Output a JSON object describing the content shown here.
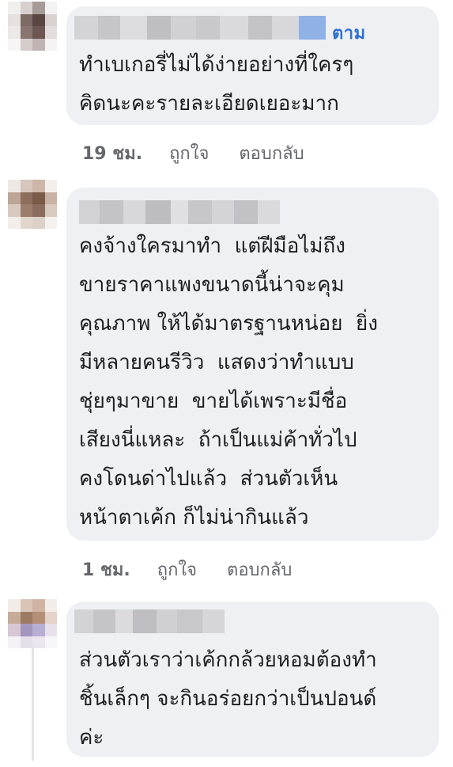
{
  "comments": [
    {
      "follow_label": "ตาม",
      "text": "ทำเบเกอรี่ไม่ได้ง่ายอย่างที่ใครๆ\nคิดนะคะรายละเอียดเยอะมาก",
      "time": "19 ชม.",
      "like_label": "ถูกใจ",
      "reply_label": "ตอบกลับ"
    },
    {
      "text": "คงจ้างใครมาทำ  แต่ฝีมือไม่ถึง\nขายราคาแพงขนาดนี้น่าจะคุม\nคุณภาพ ให้ได้มาตรฐานหน่อย  ยิ่ง\nมีหลายคนรีวิว  แสดงว่าทำแบบ\nชุ่ยๆมาขาย  ขายได้เพราะมีชื่อ\nเสียงนี่แหละ  ถ้าเป็นแม่ค้าทั่วไป\nคงโดนด่าไปแล้ว  ส่วนตัวเห็น\nหน้าตาเค้ก ก็ไม่น่ากินแล้ว",
      "time": "1 ชม.",
      "like_label": "ถูกใจ",
      "reply_label": "ตอบกลับ"
    },
    {
      "text": "ส่วนตัวเราว่าเค้กกล้วยหอมต้องทำ\nชิ้นเล็กๆ จะกินอร่อยกว่าเป็นปอนด์\nค่ะ"
    }
  ],
  "colors": {
    "bubble": "#eef0f3",
    "follow_link": "#2d6fd8",
    "meta_text": "#65676b",
    "body_text": "#1c1e21"
  }
}
